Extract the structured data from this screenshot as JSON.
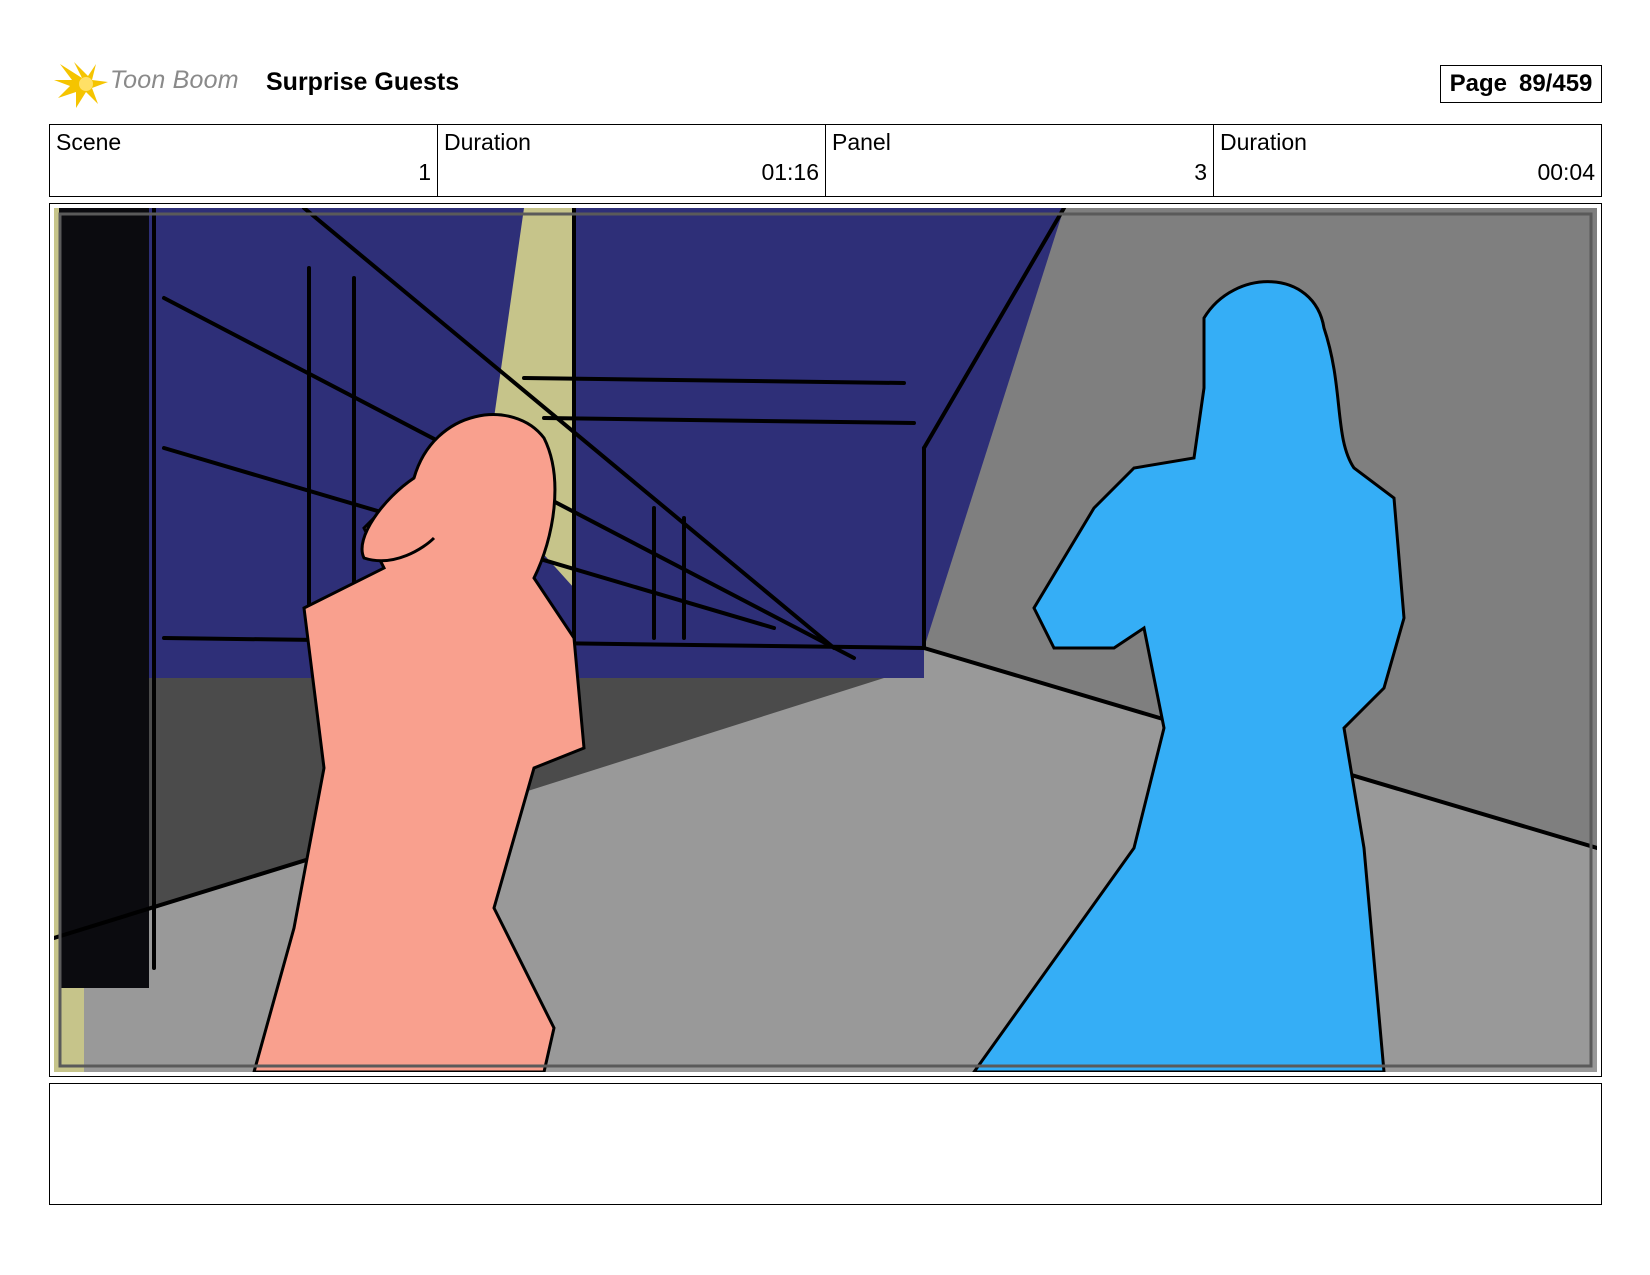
{
  "header": {
    "brand": "Toon Boom",
    "project_title": "Surprise Guests",
    "page_label": "Page",
    "page_number": "89/459"
  },
  "info": {
    "scene_label": "Scene",
    "scene_value": "1",
    "scene_duration_label": "Duration",
    "scene_duration_value": "01:16",
    "panel_label": "Panel",
    "panel_value": "3",
    "panel_duration_label": "Duration",
    "panel_duration_value": "00:04"
  },
  "colors": {
    "night_sky": "#2e2f78",
    "floor_grey": "#999999",
    "wall_grey": "#7f7f7f",
    "left_character": "#f9a08e",
    "right_character": "#35aef6",
    "spotlight": "#c6c48a",
    "logo_accent": "#f5c400"
  }
}
